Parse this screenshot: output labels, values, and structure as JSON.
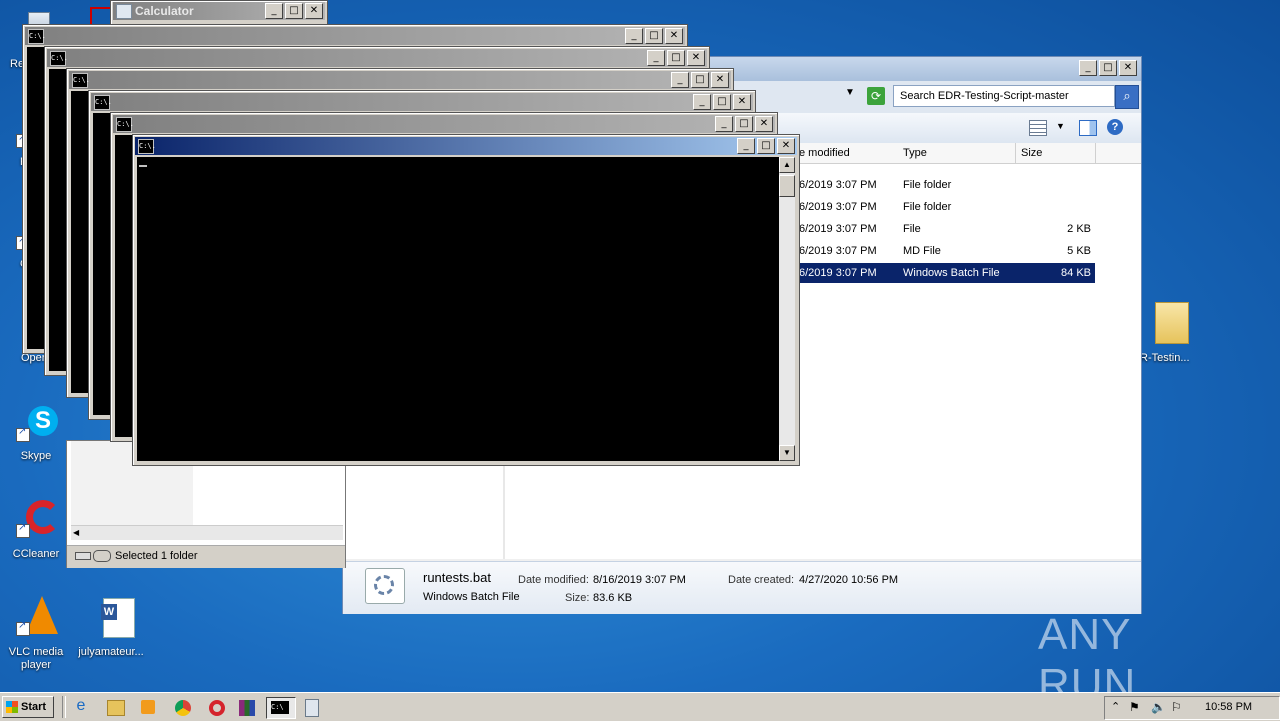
{
  "desktop": {
    "icons": [
      {
        "label": "Re",
        "name": "recycle-bin-icon"
      },
      {
        "label": "F",
        "name": "acrobat-icon"
      },
      {
        "label": "C",
        "name": "chrome-icon"
      },
      {
        "label": "Oper",
        "name": "opera-icon"
      },
      {
        "label": "Skype",
        "name": "skype-icon"
      },
      {
        "label": "CCleaner",
        "name": "ccleaner-icon"
      },
      {
        "label": "VLC media player",
        "name": "vlc-icon"
      },
      {
        "label": "julyamateur...",
        "name": "word-document-icon"
      },
      {
        "label": "R-Testin...",
        "name": "folder-icon"
      }
    ],
    "watermark": "ANY RUN"
  },
  "calculator": {
    "title": "Calculator"
  },
  "cmd_windows": [
    {
      "icon": "C:\\."
    },
    {
      "icon": "C:\\."
    },
    {
      "icon": "C:\\."
    },
    {
      "icon": "C:\\."
    },
    {
      "icon": "C:\\."
    },
    {
      "icon": "C:\\."
    }
  ],
  "explorer": {
    "search_placeholder": "Search EDR-Testing-Script-master",
    "columns": {
      "date": "e modified",
      "type": "Type",
      "size": "Size"
    },
    "rows": [
      {
        "date": "6/2019 3:07 PM",
        "type": "File folder",
        "size": ""
      },
      {
        "date": "6/2019 3:07 PM",
        "type": "File folder",
        "size": ""
      },
      {
        "date": "6/2019 3:07 PM",
        "type": "File",
        "size": "2 KB"
      },
      {
        "date": "6/2019 3:07 PM",
        "type": "MD File",
        "size": "5 KB"
      },
      {
        "date": "6/2019 3:07 PM",
        "type": "Windows Batch File",
        "size": "84 KB"
      }
    ],
    "details": {
      "filename": "runtests.bat",
      "filetype": "Windows Batch File",
      "date_modified_label": "Date modified:",
      "date_modified": "8/16/2019 3:07 PM",
      "size_label": "Size:",
      "size": "83.6 KB",
      "date_created_label": "Date created:",
      "date_created": "4/27/2020 10:56 PM"
    }
  },
  "back_explorer": {
    "status": "Selected 1 folder"
  },
  "taskbar": {
    "start": "Start",
    "clock": "10:58 PM"
  }
}
